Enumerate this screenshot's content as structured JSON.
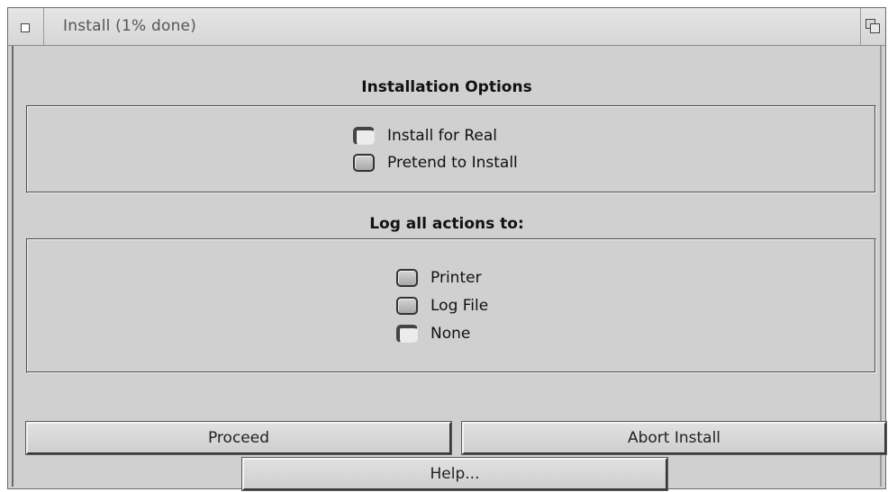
{
  "window": {
    "title": "Install (1% done)"
  },
  "installation_options": {
    "heading": "Installation Options",
    "options": [
      {
        "label": "Install for Real",
        "selected": true
      },
      {
        "label": "Pretend to Install",
        "selected": false
      }
    ]
  },
  "log": {
    "heading": "Log all actions to:",
    "options": [
      {
        "label": "Printer",
        "selected": false
      },
      {
        "label": "Log File",
        "selected": false
      },
      {
        "label": "None",
        "selected": true
      }
    ]
  },
  "buttons": {
    "proceed": "Proceed",
    "abort": "Abort Install",
    "help": "Help..."
  },
  "colors": {
    "window_bg": "#d0d0d0",
    "titlebar_bg": "#dcdcdc",
    "text": "#111111"
  }
}
